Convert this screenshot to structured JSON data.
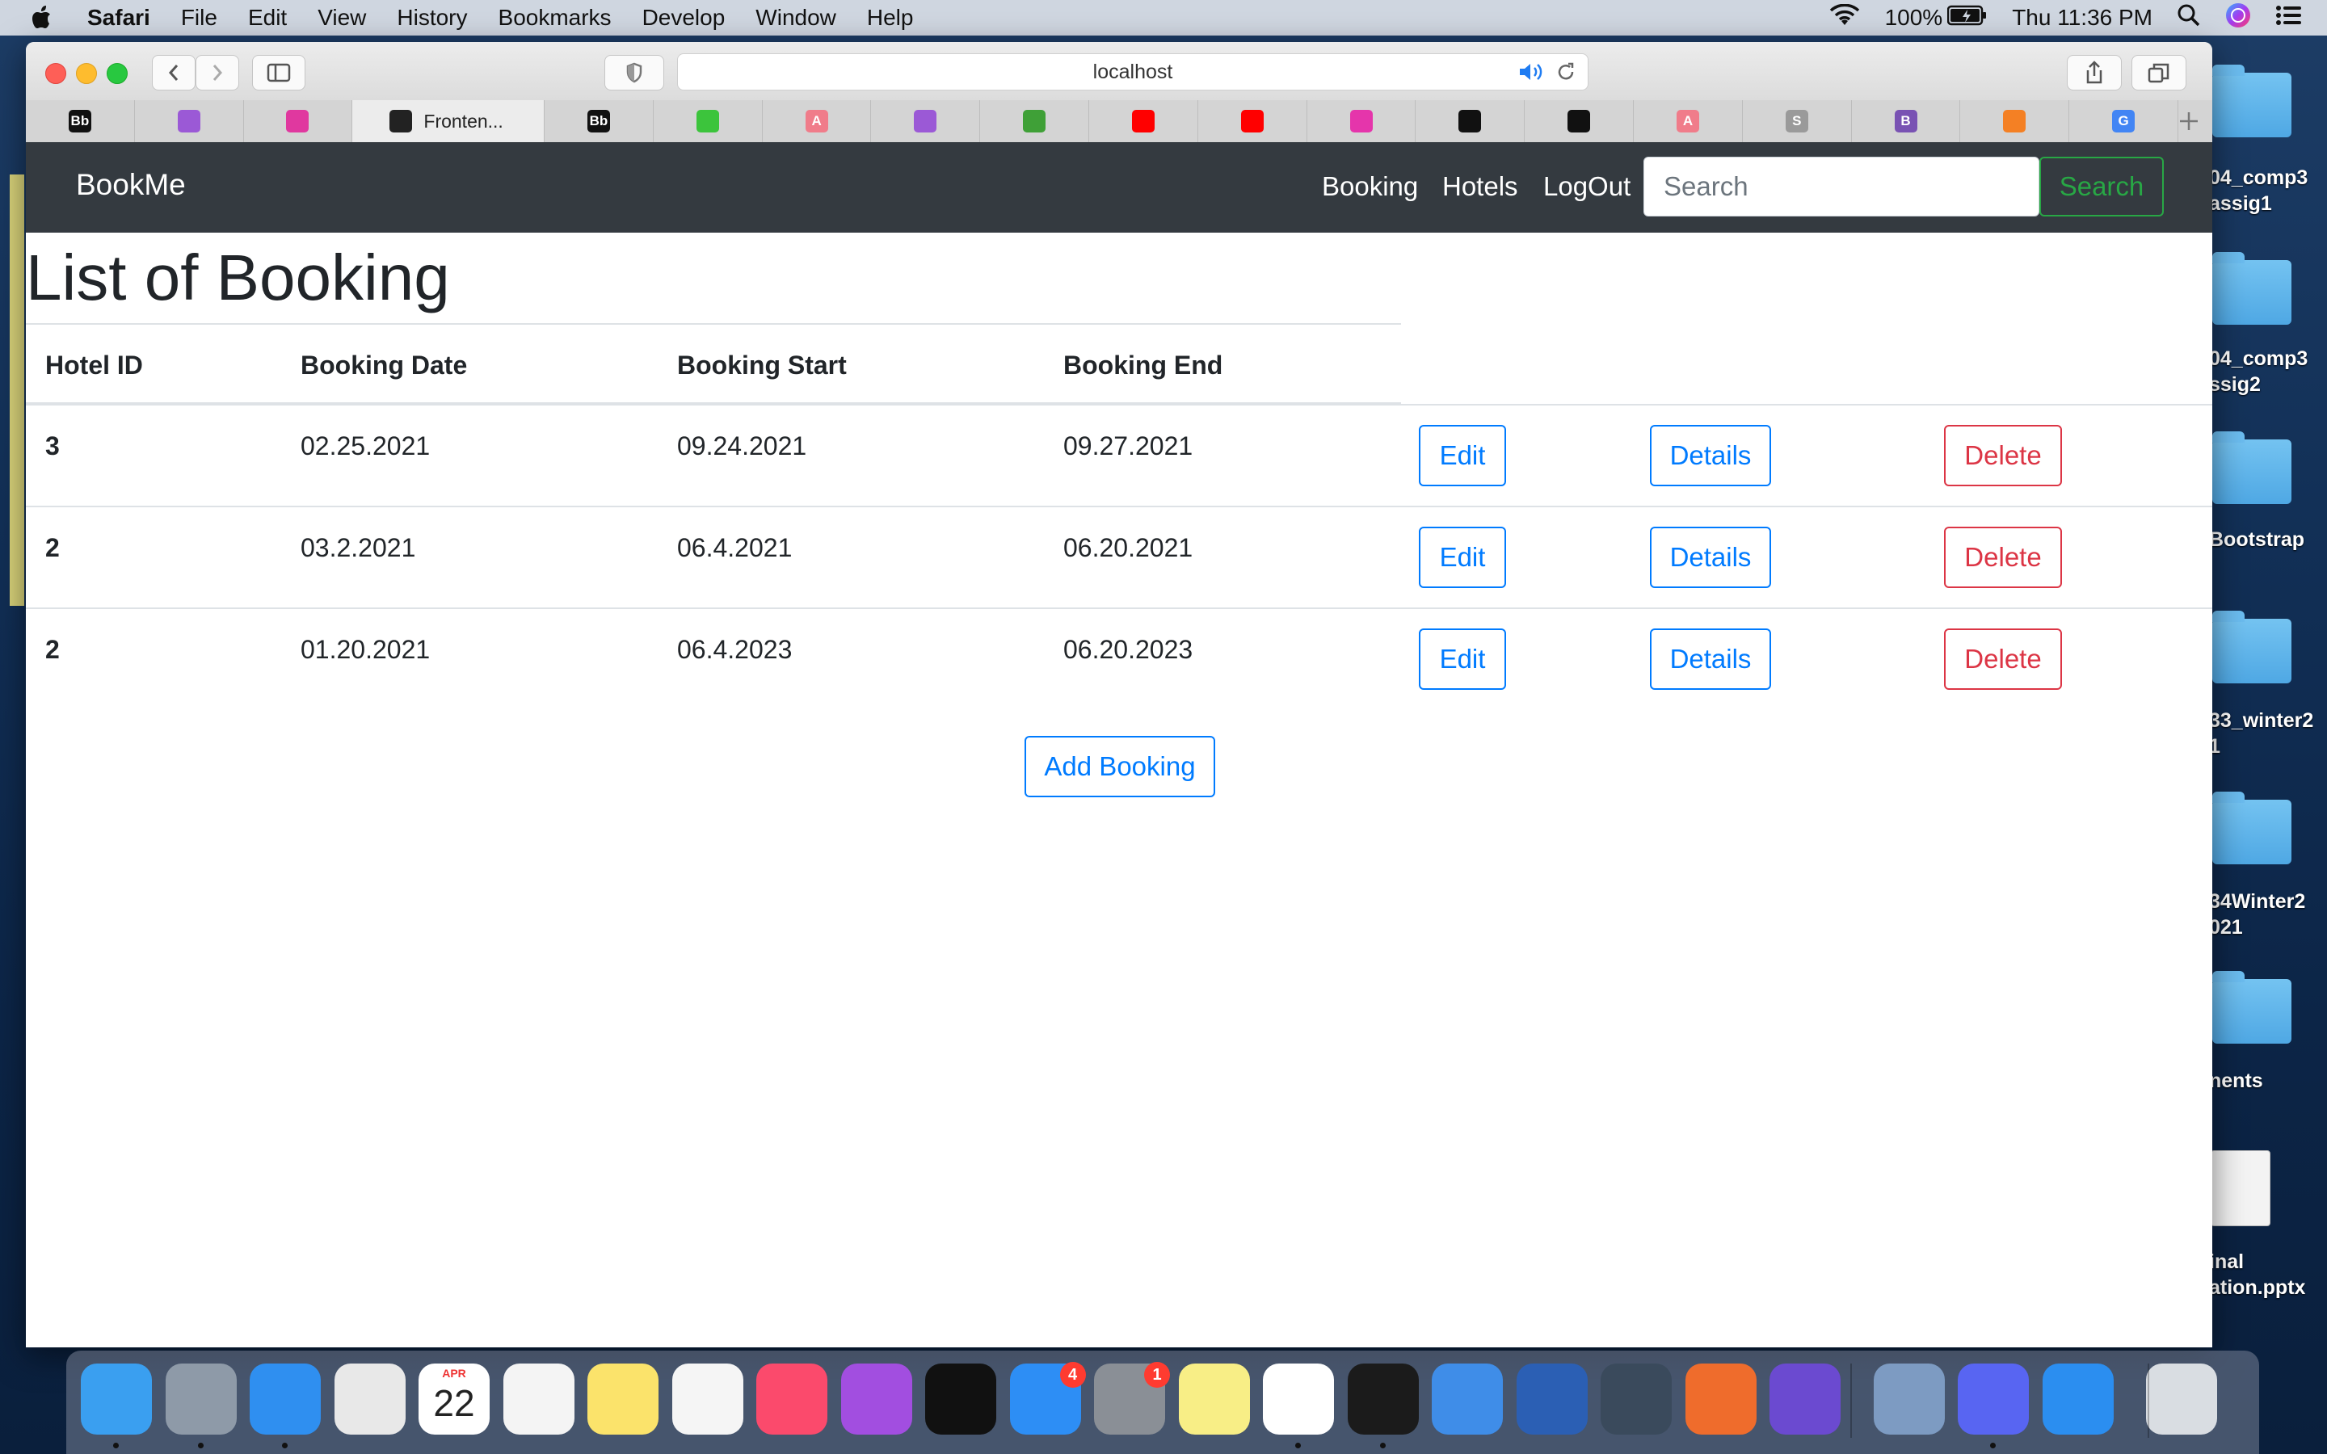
{
  "menubar": {
    "app_name": "Safari",
    "items": [
      "File",
      "Edit",
      "View",
      "History",
      "Bookmarks",
      "Develop",
      "Window",
      "Help"
    ],
    "battery": "100%",
    "clock": "Thu 11:36 PM"
  },
  "browser": {
    "url": "localhost",
    "active_tab_title": "Fronten...",
    "tabs": [
      {
        "icon": "blackboard-icon",
        "text": "Bb",
        "color": "#111111"
      },
      {
        "icon": "play-icon",
        "text": "",
        "color": "#9b59d6"
      },
      {
        "icon": "flower-icon",
        "text": "",
        "color": "#e0389f"
      },
      {
        "icon": "angular-icon",
        "text": "",
        "color": "#222222",
        "active": true
      },
      {
        "icon": "blackboard-icon",
        "text": "Bb",
        "color": "#111111"
      },
      {
        "icon": "code-icon",
        "text": "",
        "color": "#3cc43c"
      },
      {
        "icon": "a-circle-icon",
        "text": "A",
        "color": "#f07c8a"
      },
      {
        "icon": "play-icon",
        "text": "",
        "color": "#9b59d6"
      },
      {
        "icon": "leaf-icon",
        "text": "",
        "color": "#3fa037"
      },
      {
        "icon": "youtube-icon",
        "text": "",
        "color": "#ff0000"
      },
      {
        "icon": "youtube-icon",
        "text": "",
        "color": "#ff0000"
      },
      {
        "icon": "graphql-icon",
        "text": "",
        "color": "#e535ab"
      },
      {
        "icon": "github-icon",
        "text": "",
        "color": "#111111"
      },
      {
        "icon": "github-icon",
        "text": "",
        "color": "#111111"
      },
      {
        "icon": "a-circle-icon",
        "text": "A",
        "color": "#f07c8a"
      },
      {
        "icon": "s-icon",
        "text": "S",
        "color": "#9a9a9a"
      },
      {
        "icon": "bootstrap-icon",
        "text": "B",
        "color": "#7952b3"
      },
      {
        "icon": "stackoverflow-icon",
        "text": "",
        "color": "#f48024"
      },
      {
        "icon": "google-icon",
        "text": "G",
        "color": "#4285f4"
      }
    ]
  },
  "app": {
    "brand": "BookMe",
    "nav": [
      "Booking",
      "Hotels",
      "LogOut"
    ],
    "search_placeholder": "Search",
    "search_button": "Search",
    "title": "List of Booking",
    "columns": [
      "Hotel ID",
      "Booking Date",
      "Booking Start",
      "Booking End"
    ],
    "rows": [
      {
        "hotel_id": "3",
        "booking_date": "02.25.2021",
        "booking_start": "09.24.2021",
        "booking_end": "09.27.2021"
      },
      {
        "hotel_id": "2",
        "booking_date": "03.2.2021",
        "booking_start": "06.4.2021",
        "booking_end": "06.20.2021"
      },
      {
        "hotel_id": "2",
        "booking_date": "01.20.2021",
        "booking_start": "06.4.2023",
        "booking_end": "06.20.2023"
      }
    ],
    "row_actions": {
      "edit": "Edit",
      "details": "Details",
      "delete": "Delete"
    },
    "add_button": "Add Booking"
  },
  "desktop": {
    "items": [
      {
        "label": "04_comp3\nassig1"
      },
      {
        "label": "04_comp3\nssig2"
      },
      {
        "label": "Bootstrap"
      },
      {
        "label": "33_winter2\n1"
      },
      {
        "label": "34Winter2\n021"
      },
      {
        "label": "nents"
      },
      {
        "label": "inal\nation.pptx"
      }
    ]
  },
  "dock": {
    "apps": [
      {
        "name": "finder-icon",
        "color": "#3a9ff0"
      },
      {
        "name": "launchpad-icon",
        "color": "#8e9aa8"
      },
      {
        "name": "safari-icon",
        "color": "#2f8ff0"
      },
      {
        "name": "chrome-icon",
        "color": "#e8e8e8"
      },
      {
        "name": "calendar-icon",
        "color": "#ffffff"
      },
      {
        "name": "textedit-icon",
        "color": "#f4f4f4"
      },
      {
        "name": "notes-icon",
        "color": "#fbe36b"
      },
      {
        "name": "photos-icon",
        "color": "#f5f5f5"
      },
      {
        "name": "music-icon",
        "color": "#fb4a6c"
      },
      {
        "name": "podcasts-icon",
        "color": "#a24ee0"
      },
      {
        "name": "apple-tv-icon",
        "color": "#111111"
      },
      {
        "name": "app-store-icon",
        "color": "#2d8ef5",
        "badge": "4"
      },
      {
        "name": "system-preferences-icon",
        "color": "#8a8f96",
        "badge": "1"
      },
      {
        "name": "stickies-icon",
        "color": "#f8ee86"
      },
      {
        "name": "vscode-icon",
        "color": "#ffffff"
      },
      {
        "name": "terminal-icon",
        "color": "#1b1b1b"
      },
      {
        "name": "xcode-icon",
        "color": "#3f8de8"
      },
      {
        "name": "word-icon",
        "color": "#2b5fb4"
      },
      {
        "name": "quicktime-icon",
        "color": "#3a4a5c"
      },
      {
        "name": "postman-icon",
        "color": "#ef6c2c"
      },
      {
        "name": "imovie-icon",
        "color": "#6b4ad0"
      },
      {
        "name": "preview-icon",
        "color": "#7d9bc2"
      },
      {
        "name": "discord-icon",
        "color": "#5865f2"
      },
      {
        "name": "simulator-icon",
        "color": "#2b8ef0"
      },
      {
        "name": "trash-icon",
        "color": "#d9dde2"
      }
    ],
    "calendar_month": "APR",
    "calendar_day": "22"
  }
}
